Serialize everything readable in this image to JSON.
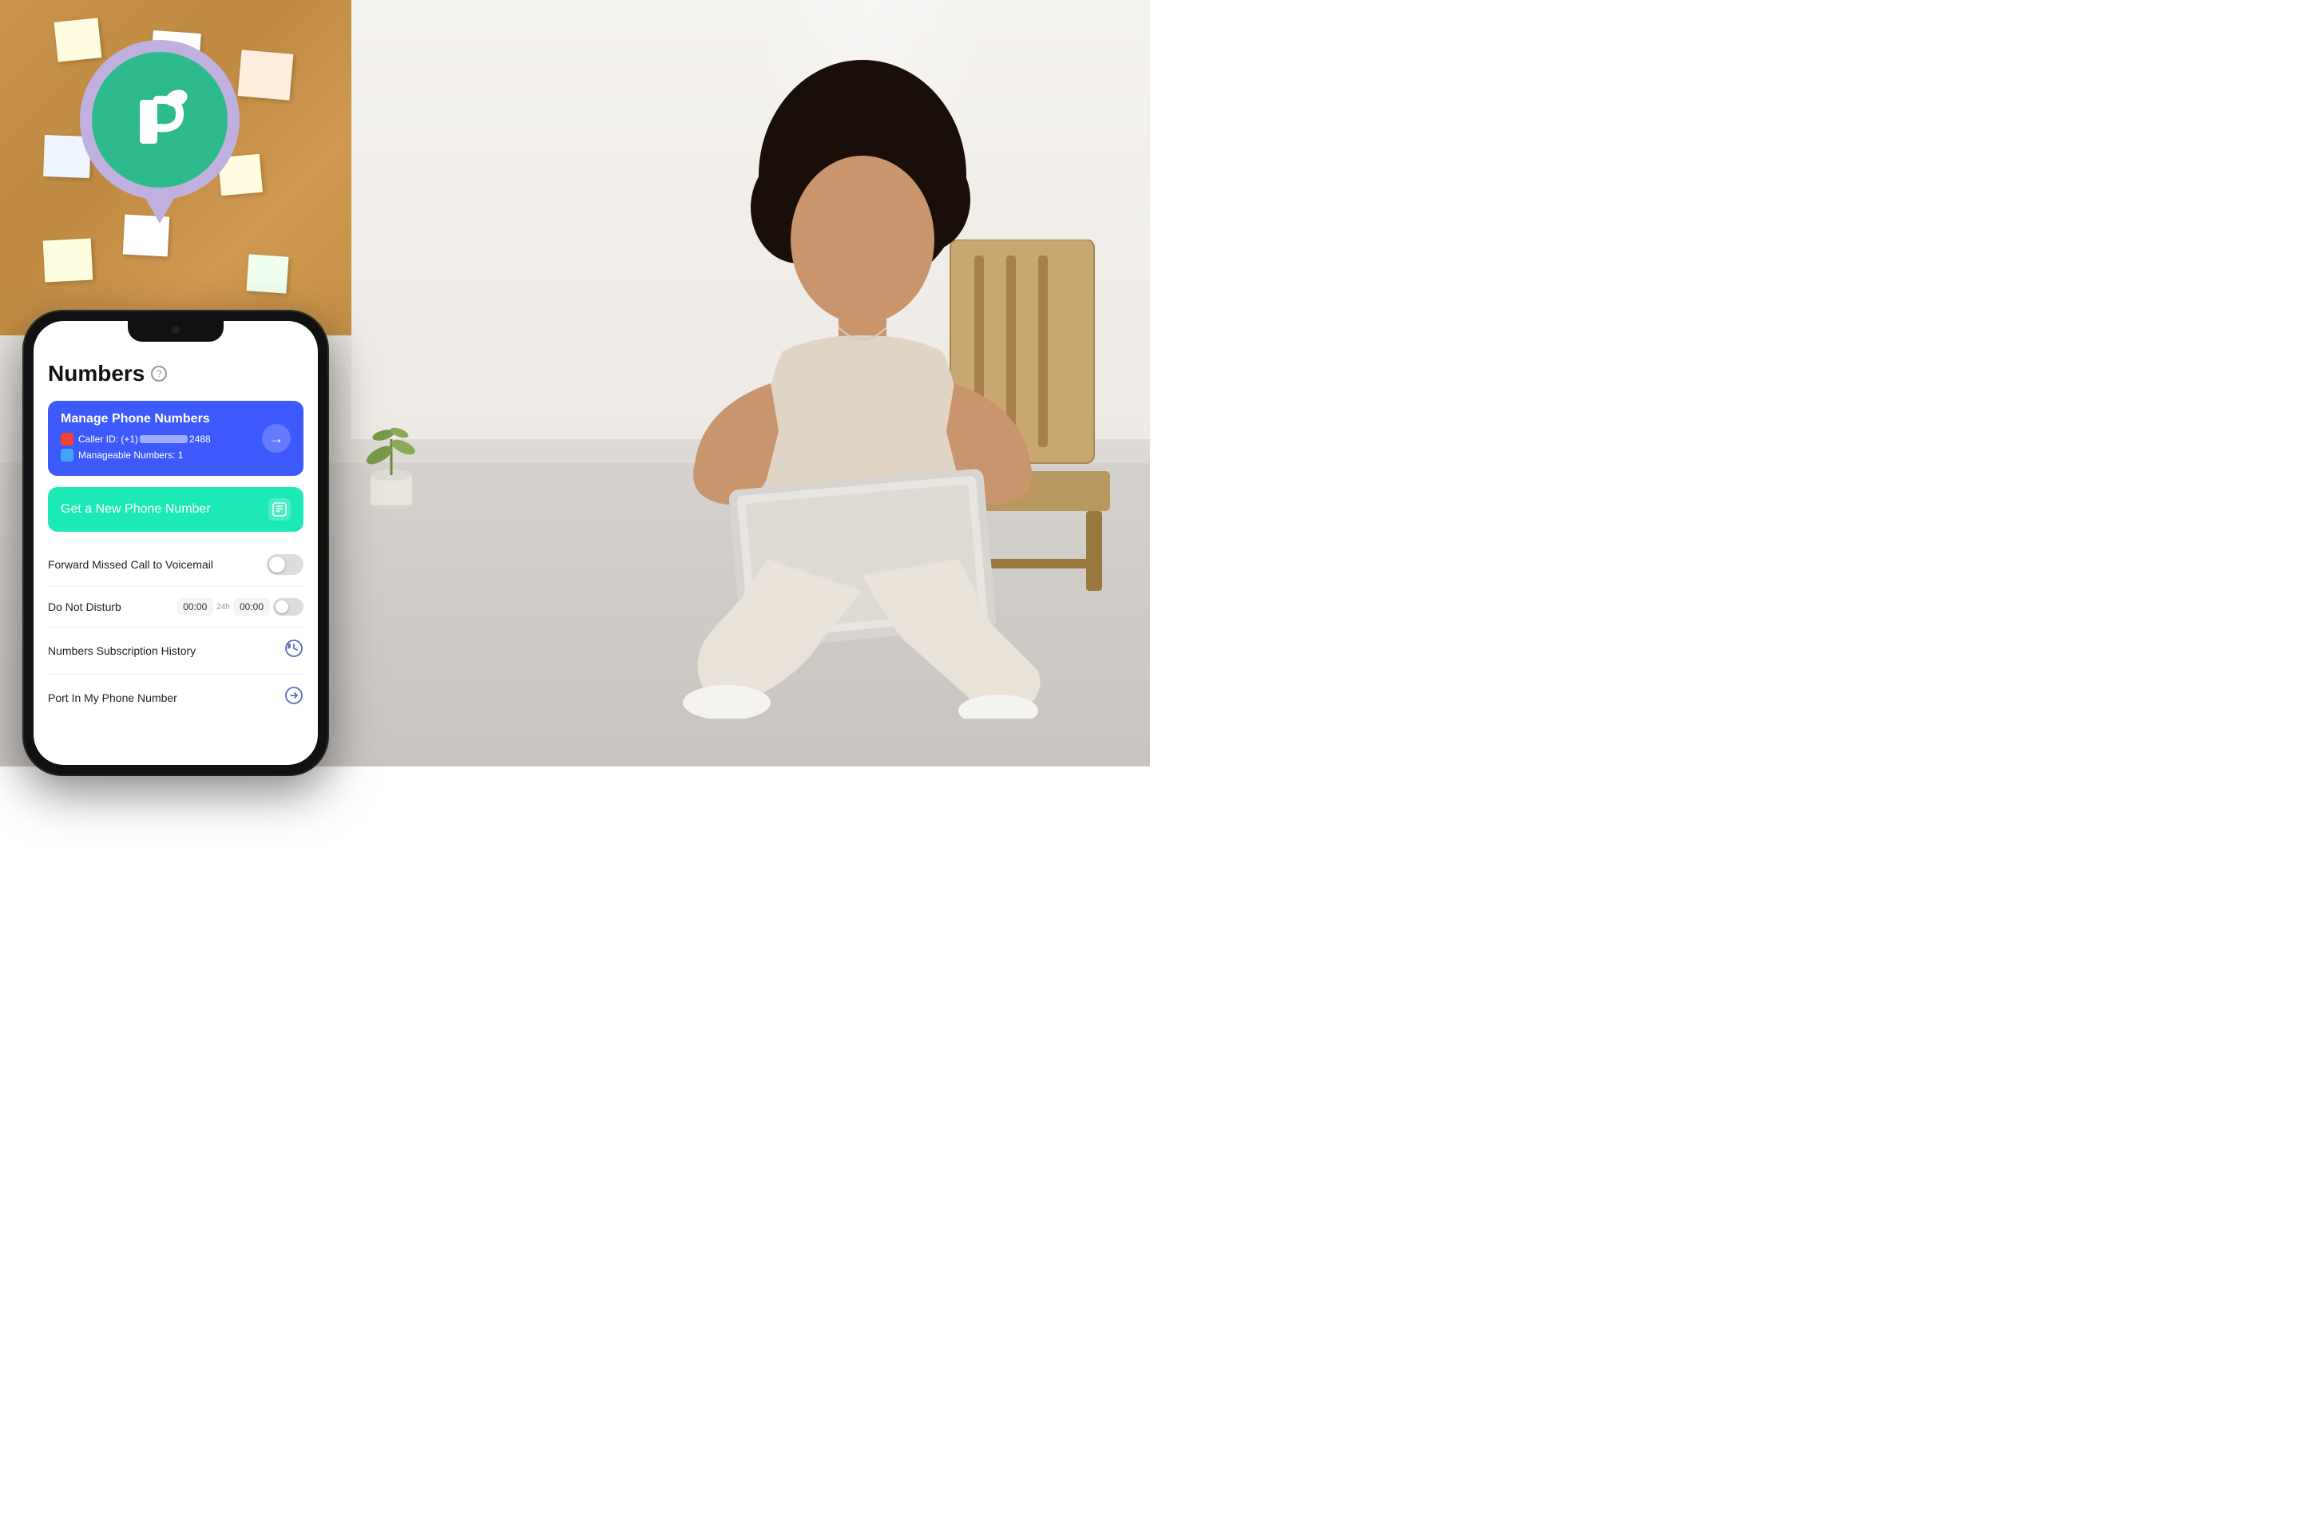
{
  "scene": {
    "background": "#f0ece7"
  },
  "logo": {
    "pin_color": "#c0b0e0",
    "circle_color": "#2dba8c",
    "icon_alt": "Talkatone app logo"
  },
  "phone": {
    "screen": {
      "title": "Numbers",
      "help_icon": "?",
      "manage_card": {
        "title": "Manage Phone Numbers",
        "caller_id_label": "Caller ID: (+1)",
        "caller_id_suffix": "2488",
        "manageable_label": "Manageable Numbers: 1",
        "arrow": "→"
      },
      "new_number_btn": {
        "label": "Get a New Phone Number",
        "icon": "📋"
      },
      "forward_missed": {
        "label": "Forward Missed Call to Voicemail",
        "toggle_on": false
      },
      "do_not_disturb": {
        "label": "Do Not Disturb",
        "time_from": "00:00",
        "time_separator": "24h",
        "time_to": "00:00",
        "toggle_on": false
      },
      "subscription_history": {
        "label": "Numbers Subscription History",
        "icon": "🕐"
      },
      "port_number": {
        "label": "Port In My Phone Number",
        "icon": "➡"
      }
    }
  }
}
